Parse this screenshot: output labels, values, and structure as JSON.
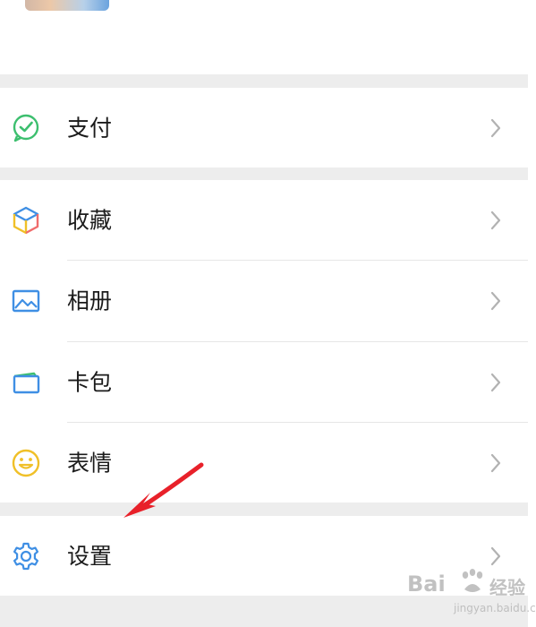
{
  "colors": {
    "background": "#ededed",
    "card": "#ffffff",
    "text": "#1b1b1b",
    "chevron": "#b2b2b2",
    "divider": "#e6e6e6",
    "pay_icon": "#3dbf6f",
    "album_icon": "#3f8fe4",
    "cards_icon": "#3f8fe4",
    "emoji_icon": "#f0c028",
    "settings_icon": "#3f8fe4",
    "annotation_arrow": "#e8212a"
  },
  "menu": {
    "pay": {
      "label": "支付",
      "icon": "wechat-pay-icon"
    },
    "favorites": {
      "label": "收藏",
      "icon": "cube-icon"
    },
    "album": {
      "label": "相册",
      "icon": "picture-icon"
    },
    "cards": {
      "label": "卡包",
      "icon": "card-wallet-icon"
    },
    "emoji": {
      "label": "表情",
      "icon": "smiley-icon"
    },
    "settings": {
      "label": "设置",
      "icon": "gear-icon"
    }
  },
  "watermark": {
    "brand": "Bai",
    "brand_suffix": "经验",
    "sub": "jingyan.baidu.com"
  }
}
